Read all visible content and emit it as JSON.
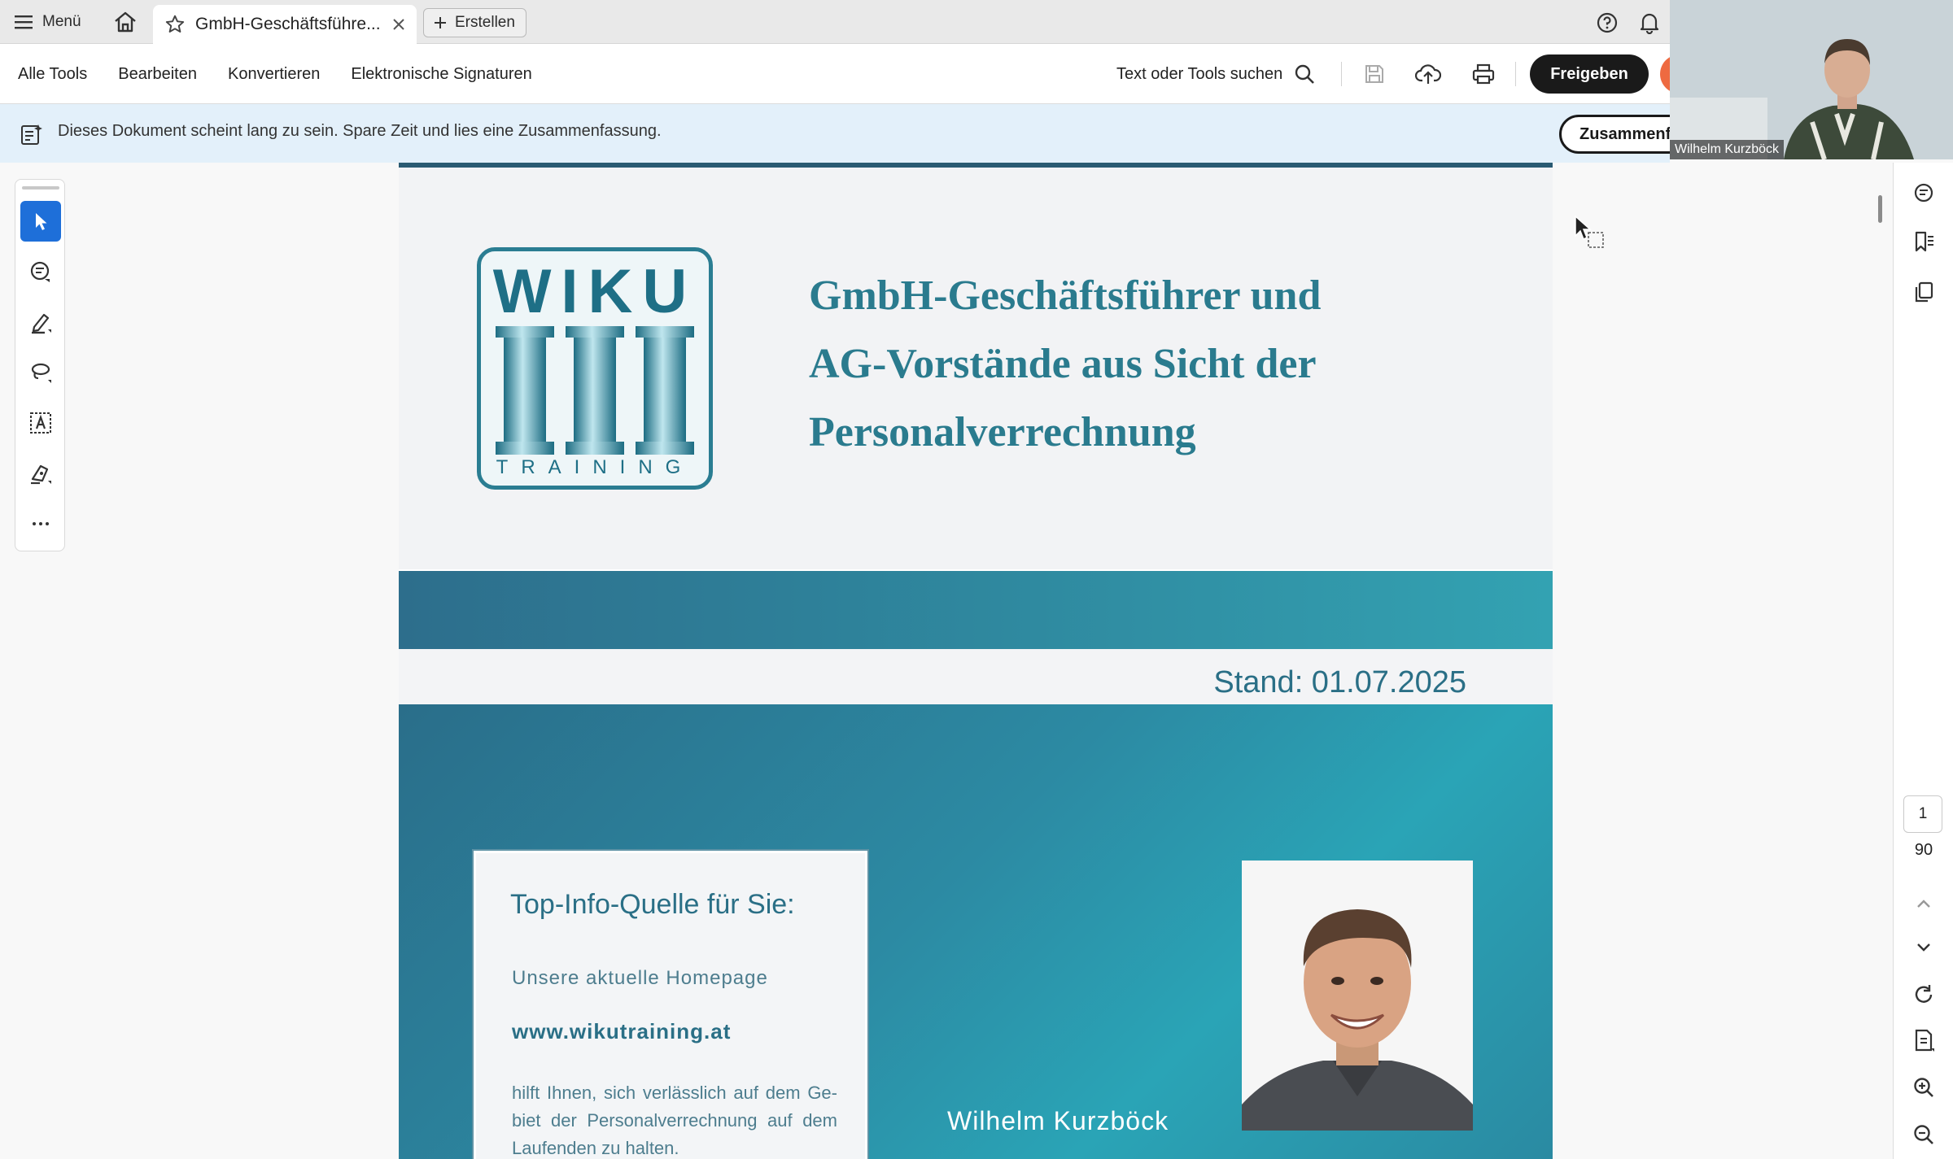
{
  "tabbar": {
    "menu_label": "Menü",
    "tab_title": "GmbH-Geschäftsführe...",
    "create_label": "Erstellen"
  },
  "toolbar": {
    "items": [
      "Alle Tools",
      "Bearbeiten",
      "Konvertieren",
      "Elektronische Signaturen"
    ],
    "search_label": "Text oder Tools suchen",
    "share_label": "Freigeben"
  },
  "banner": {
    "text": "Dieses Dokument scheint lang zu sein. Spare Zeit und lies eine Zusammenfassung.",
    "button_label": "Zusammenfassung"
  },
  "video": {
    "participant_name": "Wilhelm Kurzböck"
  },
  "document": {
    "logo_word": "WIKU",
    "logo_sub": "TRAINING",
    "title_lines": [
      "GmbH-Geschäftsführer und",
      "AG-Vorstände aus Sicht der",
      "Personalverrechnung"
    ],
    "stand": "Stand: 01.07.2025",
    "infobox": {
      "title": "Top-Info-Quelle für Sie:",
      "subtitle": "Unsere aktuelle Homepage",
      "url": "www.wikutraining.at",
      "body": "hilft Ihnen, sich verlässlich auf dem Ge-biet der Personalverrechnung auf dem Laufenden zu halten."
    },
    "author": "Wilhelm Kurzböck"
  },
  "pagination": {
    "current": "1",
    "total": "90"
  },
  "colors": {
    "accent": "#1e6fd9",
    "brand_teal": "#2a7b8e",
    "share_button": "#1a1a1a",
    "banner_bg": "#e3f0fa"
  },
  "icons": {
    "left_tools": [
      "select-arrow-icon",
      "add-comment-icon",
      "highlight-pen-icon",
      "draw-lasso-icon",
      "text-box-icon",
      "fill-sign-icon",
      "more-icon"
    ],
    "right_rail": [
      "comment-icon",
      "bookmarks-icon",
      "pages-icon",
      "rotate-icon",
      "fit-page-icon",
      "zoom-in-icon",
      "zoom-out-icon"
    ]
  }
}
